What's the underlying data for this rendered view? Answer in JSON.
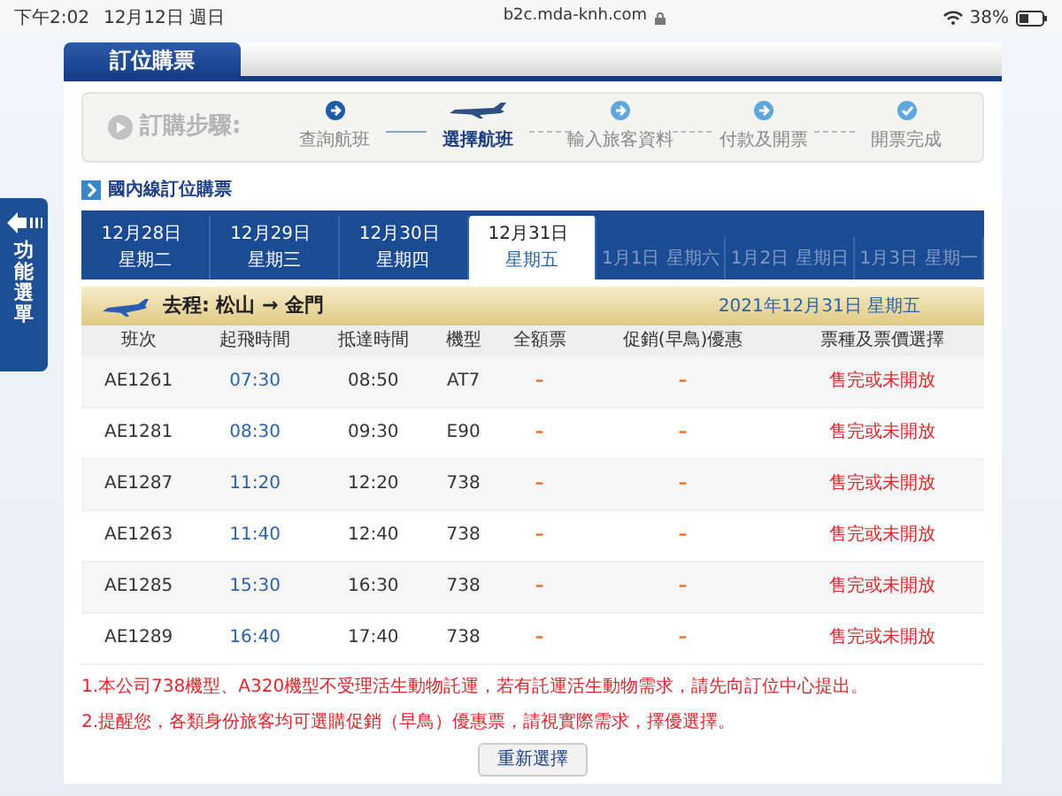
{
  "status_bar": {
    "time": "下午2:02",
    "date": "12月12日 週日",
    "url": "b2c.mda-knh.com",
    "battery": "38%"
  },
  "side_menu": {
    "label": "功能選單"
  },
  "header": {
    "title": "訂位購票"
  },
  "steps": {
    "label": "訂購步驟:",
    "items": [
      {
        "label": "查詢航班",
        "done": true,
        "selected": false,
        "kind": "arrow"
      },
      {
        "label": "選擇航班",
        "done": false,
        "selected": true,
        "kind": "plane"
      },
      {
        "label": "輸入旅客資料",
        "done": false,
        "selected": false,
        "kind": "arrow"
      },
      {
        "label": "付款及開票",
        "done": false,
        "selected": false,
        "kind": "arrow"
      },
      {
        "label": "開票完成",
        "done": false,
        "selected": false,
        "kind": "check"
      }
    ]
  },
  "section_title": "國內線訂位購票",
  "date_tabs": [
    {
      "date": "12月28日",
      "weekday": "星期二",
      "selected": false,
      "disabled": false
    },
    {
      "date": "12月29日",
      "weekday": "星期三",
      "selected": false,
      "disabled": false
    },
    {
      "date": "12月30日",
      "weekday": "星期四",
      "selected": false,
      "disabled": false
    },
    {
      "date": "12月31日",
      "weekday": "星期五",
      "selected": true,
      "disabled": false
    },
    {
      "date": "1月1日",
      "weekday": "星期六",
      "selected": false,
      "disabled": true
    },
    {
      "date": "1月2日",
      "weekday": "星期日",
      "selected": false,
      "disabled": true
    },
    {
      "date": "1月3日",
      "weekday": "星期一",
      "selected": false,
      "disabled": true
    }
  ],
  "route": {
    "label": "去程: 松山 → 金門",
    "date": "2021年12月31日 星期五"
  },
  "table": {
    "columns": [
      "班次",
      "起飛時間",
      "抵達時間",
      "機型",
      "全額票",
      "促銷(早鳥)優惠",
      "票種及票價選擇"
    ],
    "rows": [
      [
        "AE1261",
        "07:30",
        "08:50",
        "AT7",
        "–",
        "–",
        "售完或未開放"
      ],
      [
        "AE1281",
        "08:30",
        "09:30",
        "E90",
        "–",
        "–",
        "售完或未開放"
      ],
      [
        "AE1287",
        "11:20",
        "12:20",
        "738",
        "–",
        "–",
        "售完或未開放"
      ],
      [
        "AE1263",
        "11:40",
        "12:40",
        "738",
        "–",
        "–",
        "售完或未開放"
      ],
      [
        "AE1285",
        "15:30",
        "16:30",
        "738",
        "–",
        "–",
        "售完或未開放"
      ],
      [
        "AE1289",
        "16:40",
        "17:40",
        "738",
        "–",
        "–",
        "售完或未開放"
      ]
    ]
  },
  "notes": [
    "1.本公司738機型、A320機型不受理活生動物託運，若有託運活生動物需求，請先向訂位中心提出。",
    "2.提醒您，各類身份旅客均可選購促銷（早鳥）優惠票，請視實際需求，擇優選擇。"
  ],
  "reset_button": "重新選擇"
}
